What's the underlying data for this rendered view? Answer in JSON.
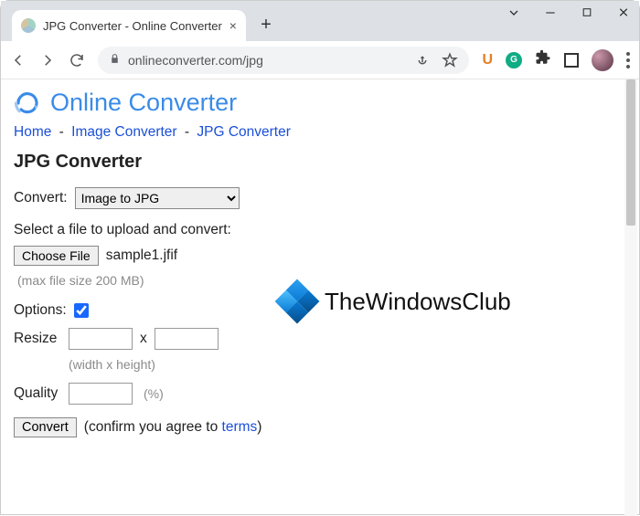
{
  "browser": {
    "tab_title": "JPG Converter - Online Converter",
    "url": "onlineconverter.com/jpg"
  },
  "site": {
    "name": "Online Converter"
  },
  "breadcrumbs": {
    "home": "Home",
    "image_converter": "Image Converter",
    "jpg_converter": "JPG Converter",
    "sep": " - "
  },
  "page": {
    "heading": "JPG Converter"
  },
  "form": {
    "convert_label": "Convert:",
    "convert_selected": "Image to JPG",
    "upload_prompt": "Select a file to upload and convert:",
    "choose_file_label": "Choose File",
    "selected_filename": "sample1.jfif",
    "max_size_hint": "(max file size 200 MB)",
    "options_label": "Options:",
    "options_checked": true,
    "resize_label": "Resize",
    "resize_width": "",
    "resize_height": "",
    "resize_x": "x",
    "resize_hint": "(width x height)",
    "quality_label": "Quality",
    "quality_value": "",
    "quality_hint": "(%)",
    "submit_label": "Convert",
    "confirm_prefix": "(confirm you agree to ",
    "terms_link": "terms",
    "confirm_suffix": ")"
  },
  "watermark": {
    "text": "TheWindowsClub"
  }
}
